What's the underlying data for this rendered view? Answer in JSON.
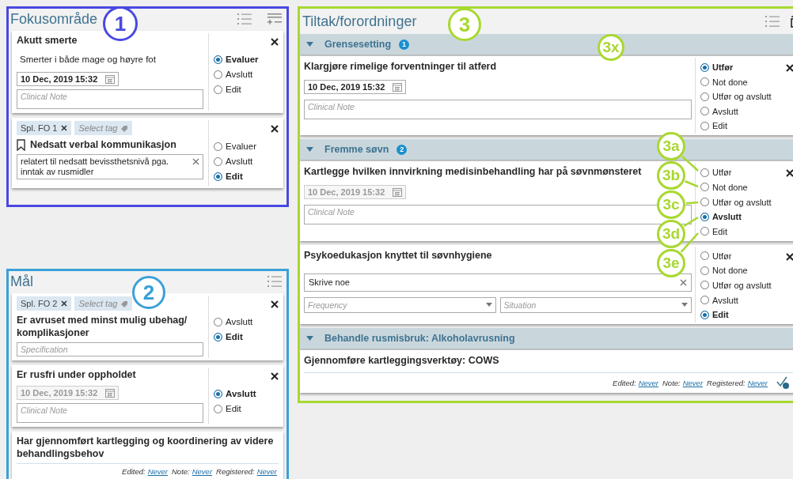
{
  "panels": [
    {
      "title": "Fokusområde",
      "color": "#4a48e0",
      "toolbar": [
        {
          "kind": "numbered-list"
        },
        {
          "kind": "add-remove"
        }
      ],
      "cards": [
        {
          "title": "Akutt smerte",
          "description": "Smerter i både mage og høyre fot",
          "fields": [
            {
              "kind": "date",
              "value": "10 Dec, 2019 15:32",
              "disabled": false
            },
            {
              "kind": "note",
              "placeholder": "Clinical Note"
            }
          ],
          "closable": true,
          "options": [
            {
              "label": "Evaluer",
              "selected": true
            },
            {
              "label": "Avslutt",
              "selected": false
            },
            {
              "label": "Edit",
              "selected": false
            }
          ]
        },
        {
          "tags": [
            {
              "label": "Spl. FO 1"
            }
          ],
          "tag_placeholder": "Select tag",
          "bookmark": true,
          "title": "Nedsatt verbal kommunikasjon",
          "fields": [
            {
              "kind": "text",
              "value": "relatert til nedsatt bevissthetsnivå pga. inntak av rusmidler"
            }
          ],
          "closable": true,
          "options": [
            {
              "label": "Evaluer",
              "selected": false
            },
            {
              "label": "Avslutt",
              "selected": false
            },
            {
              "label": "Edit",
              "selected": true
            }
          ]
        }
      ]
    },
    {
      "title": "Mål",
      "color": "#3aa0d8",
      "toolbar": [
        {
          "kind": "numbered-list"
        }
      ],
      "cards": [
        {
          "tags": [
            {
              "label": "Spl. FO 2"
            }
          ],
          "tag_placeholder": "Select tag",
          "title": "Er avruset med minst mulig ubehag/ komplikasjoner",
          "fields": [
            {
              "kind": "input",
              "placeholder": "Specification"
            }
          ],
          "closable": true,
          "options": [
            {
              "label": "Avslutt",
              "selected": false
            },
            {
              "label": "Edit",
              "selected": true
            }
          ]
        },
        {
          "title": "Er rusfri under oppholdet",
          "fields": [
            {
              "kind": "date",
              "value": "10 Dec, 2019 15:32",
              "disabled": true
            },
            {
              "kind": "note",
              "placeholder": "Clinical Note"
            }
          ],
          "closable": true,
          "options": [
            {
              "label": "Avslutt",
              "selected": true
            },
            {
              "label": "Edit",
              "selected": false
            }
          ]
        },
        {
          "title": "Har gjennomført kartlegging og koordinering av videre behandlingsbehov",
          "footer": {
            "parts": [
              {
                "label": "Edited:",
                "link": "Never"
              },
              {
                "label": "Note:",
                "link": "Never"
              },
              {
                "label": "Registered:",
                "link": "Never"
              }
            ]
          }
        }
      ]
    },
    {
      "title": "Tiltak/forordninger",
      "color": "#a8d830",
      "toolbar": [
        {
          "kind": "numbered-list"
        },
        {
          "kind": "collapse-all"
        }
      ],
      "groups": [
        {
          "title": "Grensesetting",
          "count": "1",
          "cards": [
            {
              "title": "Klargjøre rimelige forventninger til atferd",
              "fields": [
                {
                  "kind": "date",
                  "value": "10 Dec, 2019 15:32",
                  "disabled": false
                },
                {
                  "kind": "note",
                  "placeholder": "Clinical Note"
                }
              ],
              "closable": true,
              "options": [
                {
                  "label": "Utfør",
                  "selected": true
                },
                {
                  "label": "Not done",
                  "selected": false
                },
                {
                  "label": "Utfør og avslutt",
                  "selected": false
                },
                {
                  "label": "Avslutt",
                  "selected": false
                },
                {
                  "label": "Edit",
                  "selected": false
                }
              ]
            }
          ]
        },
        {
          "title": "Fremme søvn",
          "count": "2",
          "cards": [
            {
              "title": "Kartlegge hvilken innvirkning medisinbehandling har på søvnmønsteret",
              "fields": [
                {
                  "kind": "date",
                  "value": "10 Dec, 2019 15:32",
                  "disabled": true
                },
                {
                  "kind": "note",
                  "placeholder": "Clinical Note"
                }
              ],
              "closable": true,
              "options": [
                {
                  "label": "Utfør",
                  "selected": false
                },
                {
                  "label": "Not done",
                  "selected": false
                },
                {
                  "label": "Utfør og avslutt",
                  "selected": false
                },
                {
                  "label": "Avslutt",
                  "selected": true
                },
                {
                  "label": "Edit",
                  "selected": false
                }
              ]
            },
            {
              "title": "Psykoedukasjon knyttet til søvnhygiene",
              "fields": [
                {
                  "kind": "text",
                  "value": "Skrive noe"
                },
                {
                  "kind": "selects",
                  "items": [
                    {
                      "placeholder": "Frequency"
                    },
                    {
                      "placeholder": "Situation"
                    }
                  ]
                }
              ],
              "closable": true,
              "options": [
                {
                  "label": "Utfør",
                  "selected": false
                },
                {
                  "label": "Not done",
                  "selected": false
                },
                {
                  "label": "Utfør og avslutt",
                  "selected": false
                },
                {
                  "label": "Avslutt",
                  "selected": false
                },
                {
                  "label": "Edit",
                  "selected": true
                }
              ]
            }
          ]
        },
        {
          "title": "Behandle rusmisbruk: Alkoholavrusning",
          "cards": [
            {
              "title": "Gjennomføre kartleggingsverktøy: COWS",
              "footer": {
                "check": true,
                "parts": [
                  {
                    "label": "Edited:",
                    "link": "Never"
                  },
                  {
                    "label": "Note:",
                    "link": "Never"
                  },
                  {
                    "label": "Registered:",
                    "link": "Never"
                  }
                ]
              }
            }
          ]
        }
      ]
    }
  ],
  "callouts": [
    {
      "label": "1",
      "color": "#4a48e0"
    },
    {
      "label": "2",
      "color": "#3aa0d8"
    },
    {
      "label": "3",
      "color": "#a8d830"
    },
    {
      "label": "3x",
      "color": "#a8d830"
    },
    {
      "label": "3a",
      "color": "#a8d830"
    },
    {
      "label": "3b",
      "color": "#a8d830"
    },
    {
      "label": "3c",
      "color": "#a8d830"
    },
    {
      "label": "3d",
      "color": "#a8d830"
    },
    {
      "label": "3e",
      "color": "#a8d830"
    }
  ]
}
